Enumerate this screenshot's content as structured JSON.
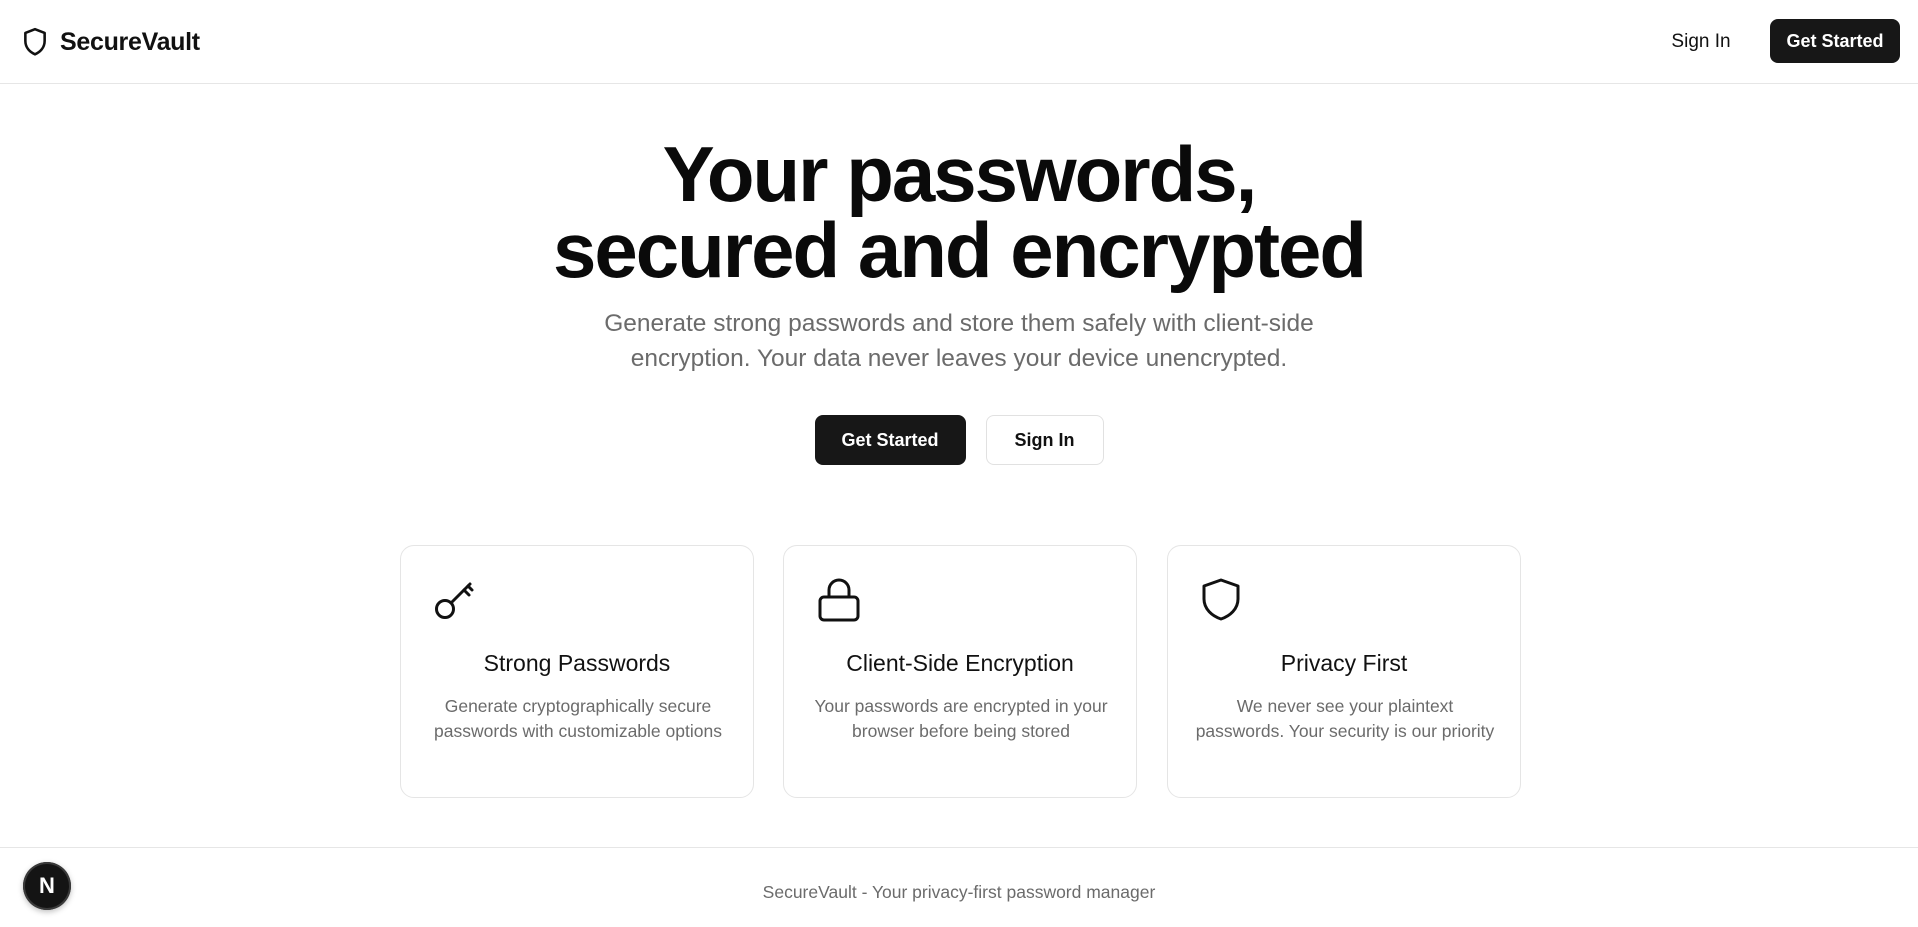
{
  "header": {
    "brand_name": "SecureVault",
    "brand_icon": "shield-icon",
    "nav": {
      "signin_label": "Sign In",
      "get_started_label": "Get Started"
    }
  },
  "hero": {
    "title_line1": "Your passwords,",
    "title_line2": "secured and encrypted",
    "subtitle": "Generate strong passwords and store them safely with client-side encryption. Your data never leaves your device unencrypted.",
    "primary_button": "Get Started",
    "secondary_button": "Sign In"
  },
  "features": [
    {
      "icon": "key-icon",
      "title": "Strong Passwords",
      "description": "Generate cryptographically secure passwords with customizable options"
    },
    {
      "icon": "lock-icon",
      "title": "Client-Side Encryption",
      "description": "Your passwords are encrypted in your browser before being stored"
    },
    {
      "icon": "shield-icon",
      "title": "Privacy First",
      "description": "We never see your plaintext passwords. Your security is our priority"
    }
  ],
  "footer": {
    "text": "SecureVault - Your privacy-first password manager"
  },
  "dev_badge": {
    "letter": "N"
  },
  "colors": {
    "primary": "#171717",
    "muted_text": "#6b6b6b",
    "border": "#e5e5e5",
    "background": "#ffffff"
  }
}
